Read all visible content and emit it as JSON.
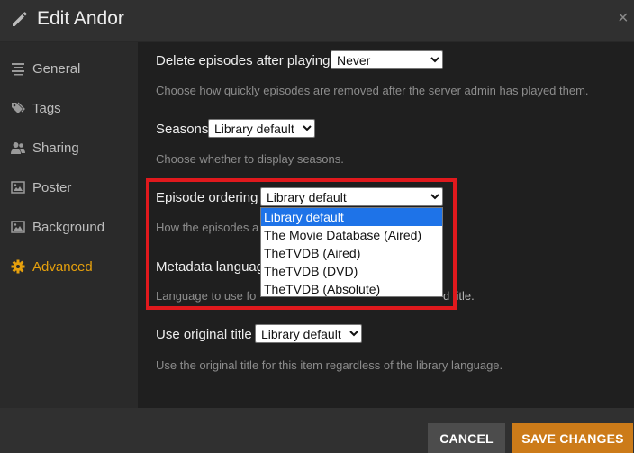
{
  "header": {
    "title": "Edit Andor",
    "icon": "pencil-icon",
    "close_icon": "close-icon",
    "close_glyph": "×"
  },
  "sidebar": {
    "items": [
      {
        "label": "General",
        "icon": "general-icon"
      },
      {
        "label": "Tags",
        "icon": "tag-icon"
      },
      {
        "label": "Sharing",
        "icon": "sharing-icon"
      },
      {
        "label": "Poster",
        "icon": "poster-icon"
      },
      {
        "label": "Background",
        "icon": "background-icon"
      },
      {
        "label": "Advanced",
        "icon": "gear-icon",
        "active": true
      }
    ]
  },
  "settings": {
    "delete_episodes": {
      "label": "Delete episodes after playing",
      "value": "Never",
      "help": "Choose how quickly episodes are removed after the server admin has played them."
    },
    "seasons": {
      "label": "Seasons",
      "value": "Library default",
      "help": "Choose whether to display seasons."
    },
    "episode_ordering": {
      "label": "Episode ordering",
      "value": "Library default",
      "help": "How the episodes a",
      "options": [
        "Library default",
        "The Movie Database (Aired)",
        "TheTVDB (Aired)",
        "TheTVDB (DVD)",
        "TheTVDB (Absolute)"
      ]
    },
    "metadata_language": {
      "label": "Metadata languag",
      "help_start": "Language to use fo",
      "help_end": "d title."
    },
    "original_title": {
      "label": "Use original title",
      "value": "Library default",
      "help": "Use the original title for this item regardless of the library language."
    }
  },
  "footer": {
    "cancel_label": "CANCEL",
    "save_label": "SAVE CHANGES"
  },
  "colors": {
    "accent": "#e5a00d",
    "save_button": "#cc7b19",
    "highlight": "#e0191d",
    "dropdown_selected": "#1e73e8"
  }
}
